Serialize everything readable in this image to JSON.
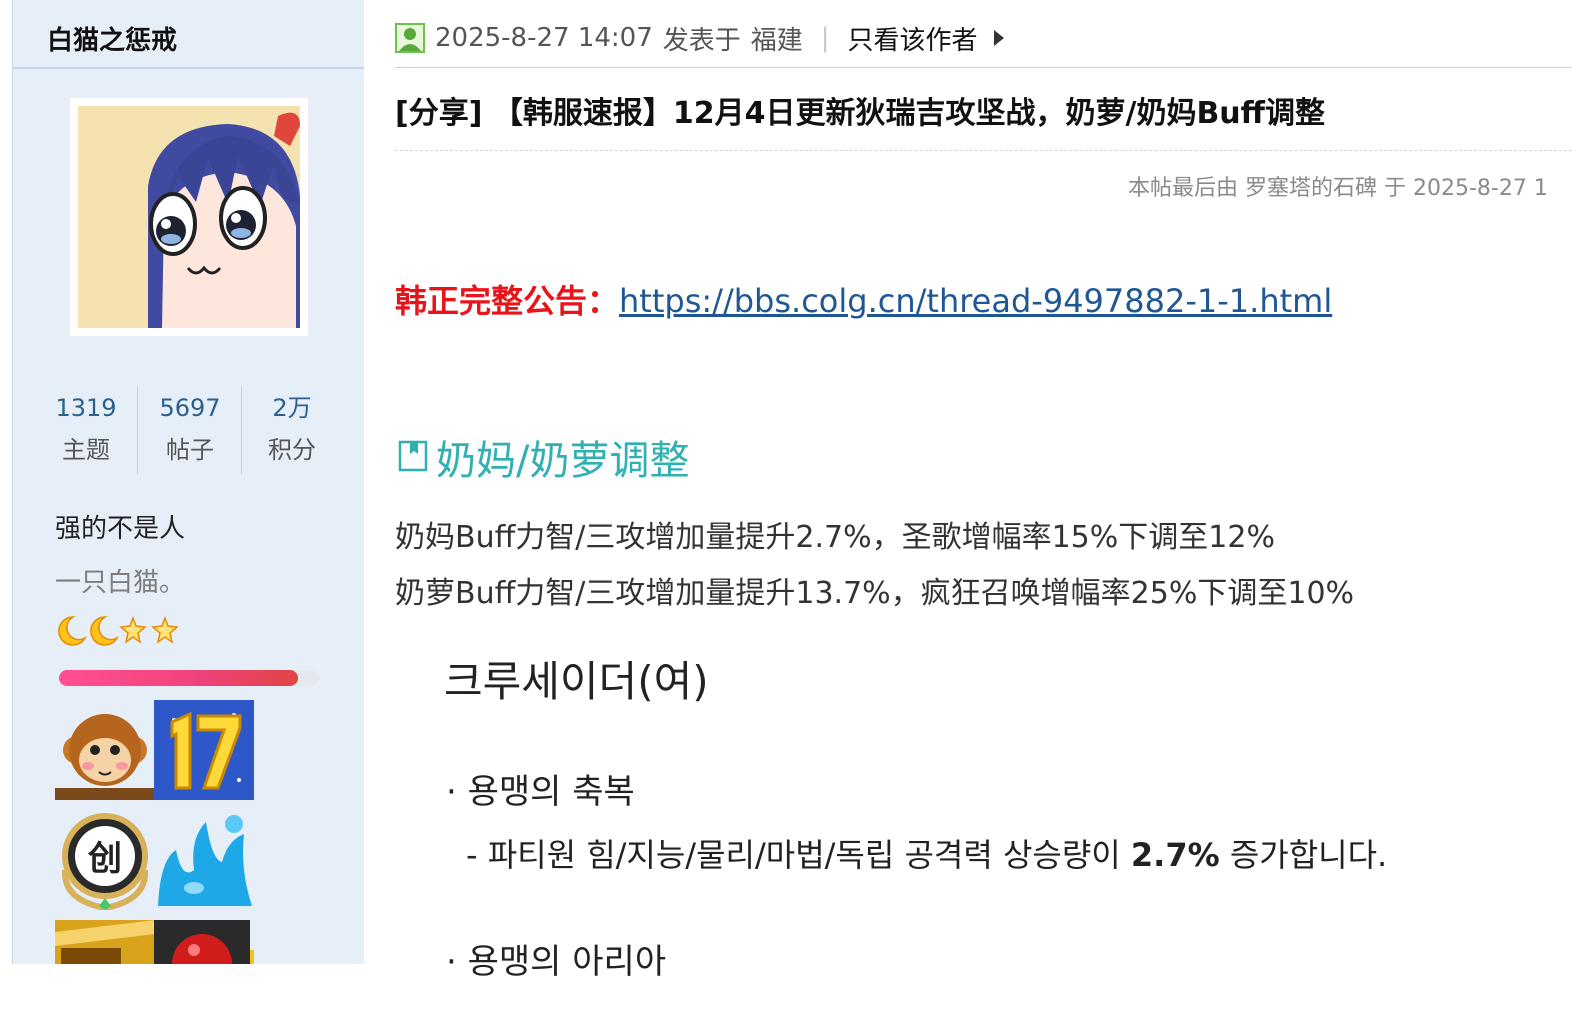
{
  "author": {
    "name": "白猫之惩戒",
    "stats": [
      {
        "value": "1319",
        "label": "主题"
      },
      {
        "value": "5697",
        "label": "帖子"
      },
      {
        "value": "2万",
        "label": "积分"
      }
    ],
    "status": "强的不是人",
    "custom_title": "一只白猫。",
    "rank_icons": [
      "moon-icon",
      "moon-icon",
      "star-icon",
      "star-icon"
    ],
    "level_progress": 0.92,
    "medals": [
      "monkey-medal-icon",
      "number-17-medal-icon",
      "chuang-medal-icon",
      "water-splash-medal-icon",
      "gold-medal-icon",
      "red-medal-icon"
    ]
  },
  "post": {
    "meta": {
      "datetime": "2025-8-27 14:07",
      "posted_in": "发表于",
      "location": "福建",
      "only_author": "只看该作者"
    },
    "title": "[分享] 【韩服速报】12月4日更新狄瑞吉攻坚战，奶萝/奶妈Buff调整",
    "edit_note": "本帖最后由 罗塞塔的石碑 于 2025-8-27 1",
    "announcement": {
      "label": "韩正完整公告：",
      "link": "https://bbs.colg.cn/thread-9497882-1-1.html"
    },
    "section_title": "奶妈/奶萝调整",
    "lines": [
      "奶妈Buff力智/三攻增加量提升2.7%，圣歌增幅率15%下调至12%",
      "奶萝Buff力智/三攻增加量提升13.7%，疯狂召唤增幅率25%下调至10%"
    ],
    "image_text": {
      "heading": "크루세이더(여)",
      "bullet1": "· 용맹의 축복",
      "detail_prefix": "- 파티원 힘/지능/물리/마법/독립 공격력 상승량이 ",
      "detail_value": "2.7%",
      "detail_suffix": " 증가합니다.",
      "bullet2": "· 용맹의 아리아"
    }
  },
  "colors": {
    "sidebar_bg": "#e6eff8",
    "link": "#1f5796",
    "announce_red": "#e8141a",
    "section_teal": "#2fb0b2",
    "stat_blue": "#2a5f8e"
  }
}
